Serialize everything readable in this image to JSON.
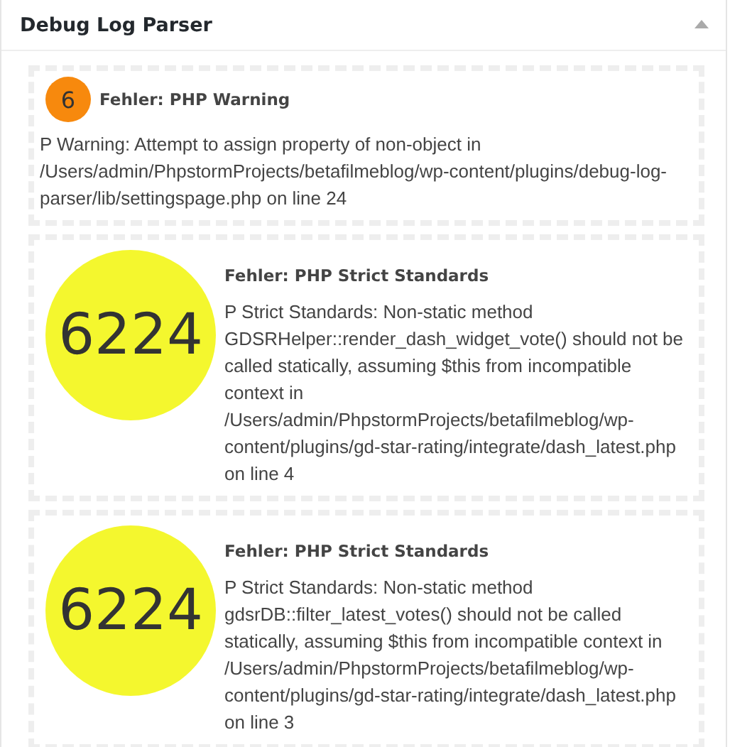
{
  "panel": {
    "title": "Debug Log Parser"
  },
  "entries": [
    {
      "count": "6",
      "kind": "small",
      "color": "#f7890d",
      "title": "Fehler: PHP Warning",
      "message": "P Warning: Attempt to assign property of non-object in /Users/admin/PhpstormProjects/betafilmeblog/wp-content/plugins/debug-log-parser/lib/settingspage.php on line 24"
    },
    {
      "count": "6224",
      "kind": "large",
      "color": "#f4f72e",
      "title": "Fehler: PHP Strict Standards",
      "message": "P Strict Standards: Non-static method GDSRHelper::render_dash_widget_vote() should not be called statically, assuming $this from incompatible context in /Users/admin/PhpstormProjects/betafilmeblog/wp-content/plugins/gd-star-rating/integrate/dash_latest.php on line 4"
    },
    {
      "count": "6224",
      "kind": "large",
      "color": "#f4f72e",
      "title": "Fehler: PHP Strict Standards",
      "message": "P Strict Standards: Non-static method gdsrDB::filter_latest_votes() should not be called statically, assuming $this from incompatible context in /Users/admin/PhpstormProjects/betafilmeblog/wp-content/plugins/gd-star-rating/integrate/dash_latest.php on line 3"
    }
  ]
}
